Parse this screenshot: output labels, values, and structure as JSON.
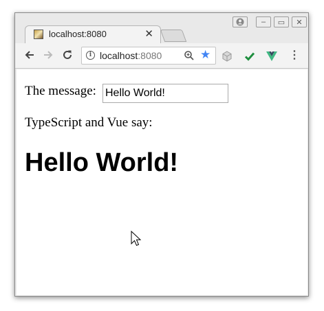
{
  "browser": {
    "tab": {
      "title": "localhost:8080"
    },
    "address_bar": {
      "host": "localhost",
      "port": ":8080"
    }
  },
  "page": {
    "message_label": "The message:",
    "message_value": "Hello World!",
    "say_text": "TypeScript and Vue say:",
    "heading": "Hello World!"
  },
  "icons": {
    "favicon": "favicon-icon",
    "tab_close": "close-icon",
    "back": "back-arrow-icon",
    "forward": "forward-arrow-icon",
    "reload": "reload-icon",
    "info": "info-icon",
    "zoom": "zoom-icon",
    "bookmark": "star-icon",
    "extensions": [
      "cube-icon",
      "checkmark-icon",
      "vue-devtools-icon"
    ],
    "menu": "kebab-menu-icon"
  },
  "colors": {
    "star": "#4285f4",
    "checkmark": "#1e8e3e",
    "vue": "#41b883"
  }
}
